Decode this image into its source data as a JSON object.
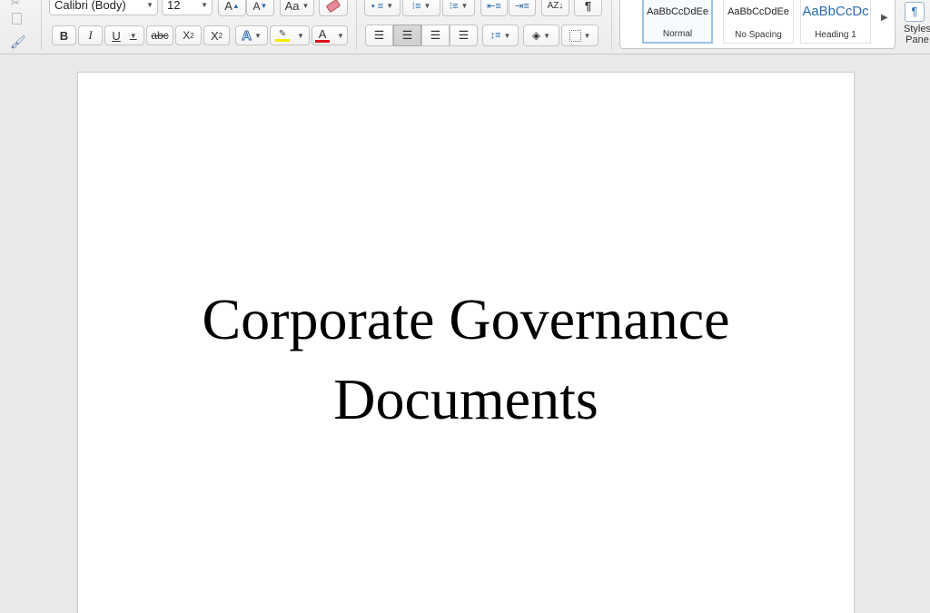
{
  "ribbon": {
    "font": {
      "name": "Calibri (Body)",
      "size": "12"
    },
    "buttons": {
      "grow": "A",
      "shrink": "A",
      "change_case": "Aa",
      "bold": "B",
      "italic": "I",
      "underline": "U",
      "strikethrough": "abc",
      "subscript": "X",
      "subscript_mark": "2",
      "superscript": "X",
      "superscript_mark": "2",
      "text_effects": "A",
      "font_color": "A",
      "pilcrow": "¶"
    },
    "colors": {
      "highlight": "#f5e800",
      "font_color": "#e0141b",
      "accent": "#2e6cb0"
    },
    "styles": [
      {
        "sample": "AaBbCcDdEe",
        "label": "Normal",
        "selected": true
      },
      {
        "sample": "AaBbCcDdEe",
        "label": "No Spacing",
        "selected": false
      },
      {
        "sample": "AaBbCcDc",
        "label": "Heading 1",
        "selected": false
      }
    ],
    "styles_pane": {
      "line1": "Styles",
      "line2": "Pane"
    }
  },
  "document": {
    "title_line1": "Corporate Governance",
    "title_line2": "Documents"
  }
}
